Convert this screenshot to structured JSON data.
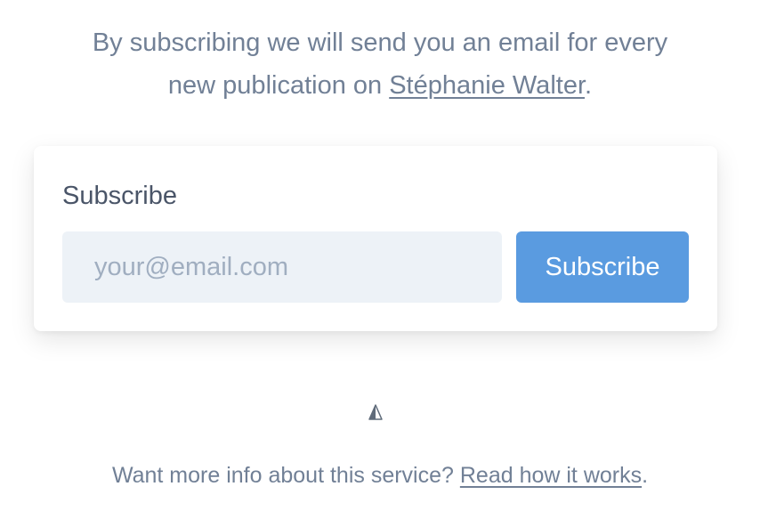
{
  "intro": {
    "line1": "By subscribing we will send you an email for every",
    "line2_prefix": "new publication on ",
    "link_label": "Stéphanie Walter",
    "line2_suffix": "."
  },
  "card": {
    "title": "Subscribe",
    "email_placeholder": "your@email.com",
    "email_value": "",
    "button_label": "Subscribe",
    "accent_color": "#5a9be0"
  },
  "brand": {
    "icon": "sail-triangle-icon"
  },
  "footer": {
    "text": "Want more info about this service? ",
    "link_label": "Read how it works",
    "suffix": "."
  }
}
